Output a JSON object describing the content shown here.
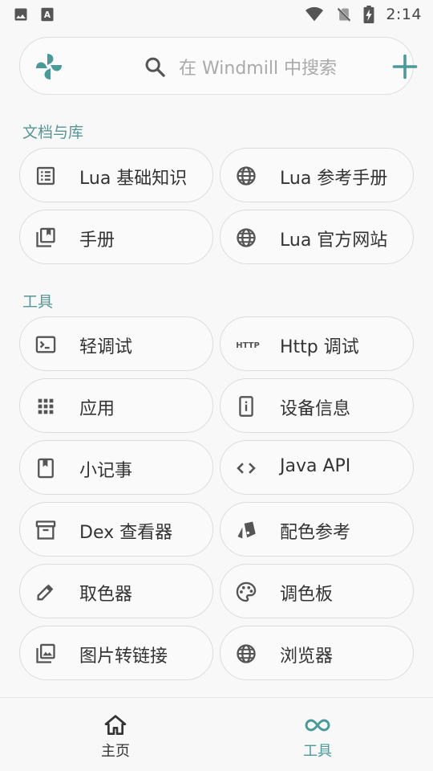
{
  "status_bar": {
    "time": "2:14",
    "icons": [
      "image-icon",
      "font-icon",
      "wifi-icon",
      "no-sim-icon",
      "battery-charging-icon"
    ]
  },
  "search": {
    "placeholder": "在 Windmill 中搜索",
    "logo_icon": "windmill-logo-icon",
    "search_icon": "search-icon",
    "add_icon": "add-icon"
  },
  "sections": [
    {
      "title": "文档与库",
      "items": [
        {
          "label": "Lua 基础知识",
          "icon": "list-document-icon"
        },
        {
          "label": "Lua 参考手册",
          "icon": "globe-icon"
        },
        {
          "label": "手册",
          "icon": "library-book-icon"
        },
        {
          "label": "Lua 官方网站",
          "icon": "globe-icon"
        }
      ]
    },
    {
      "title": "工具",
      "items": [
        {
          "label": "轻调试",
          "icon": "terminal-icon"
        },
        {
          "label": "Http 调试",
          "icon": "http-icon",
          "icon_text": "HTTP"
        },
        {
          "label": "应用",
          "icon": "apps-grid-icon"
        },
        {
          "label": "设备信息",
          "icon": "device-info-icon"
        },
        {
          "label": "小记事",
          "icon": "bookmark-book-icon"
        },
        {
          "label": "Java API",
          "icon": "code-icon"
        },
        {
          "label": "Dex 查看器",
          "icon": "archive-box-icon"
        },
        {
          "label": "配色参考",
          "icon": "color-swatch-icon"
        },
        {
          "label": "取色器",
          "icon": "color-picker-icon"
        },
        {
          "label": "调色板",
          "icon": "palette-icon"
        },
        {
          "label": "图片转链接",
          "icon": "image-library-icon"
        },
        {
          "label": "浏览器",
          "icon": "globe-icon"
        }
      ]
    }
  ],
  "bottom_nav": {
    "home_label": "主页",
    "tools_label": "工具",
    "active": "tools"
  },
  "colors": {
    "accent": "#4a9a9a",
    "section_title": "#5a9595",
    "background": "#f8f8f8",
    "icon": "#555555"
  }
}
